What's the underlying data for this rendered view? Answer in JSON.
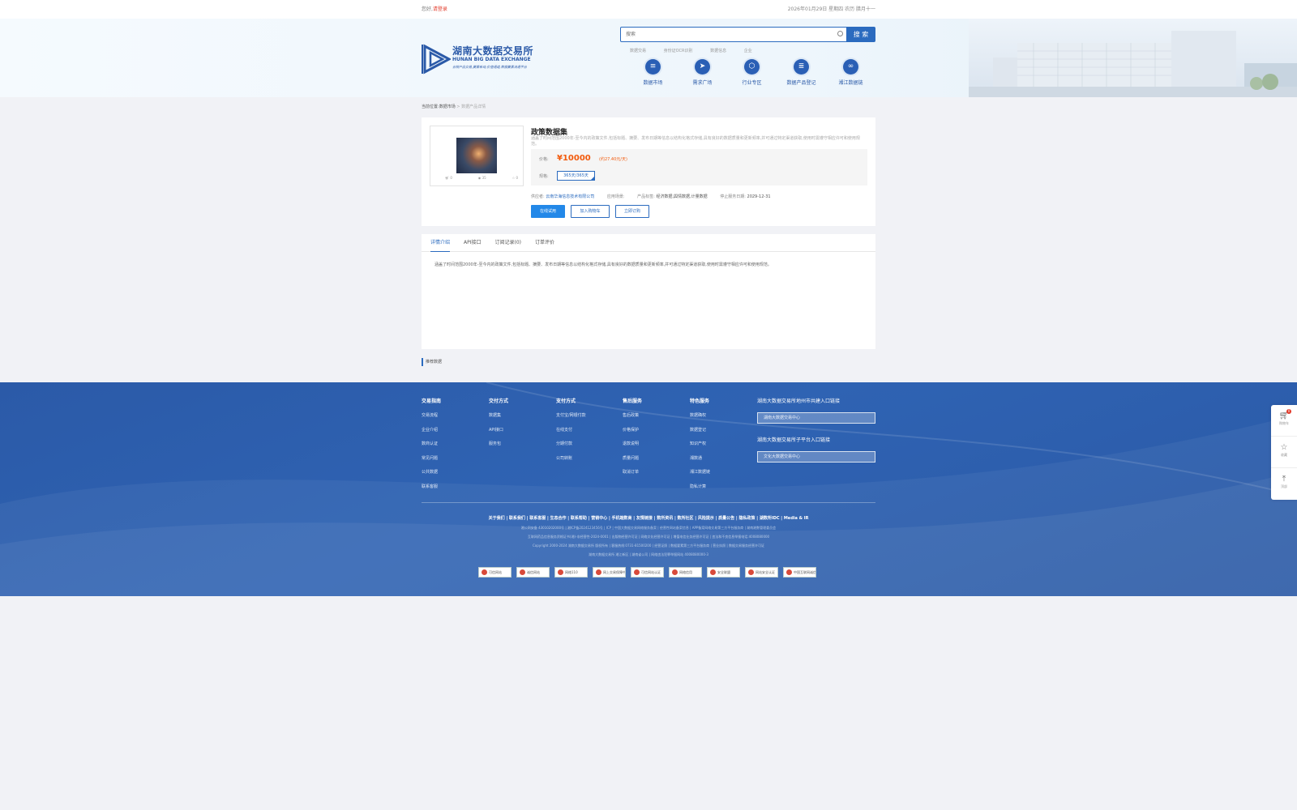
{
  "topbar": {
    "greeting": "您好,",
    "login_link": "请登录",
    "date": "2026年01月29日 星期四 农历 腊月十一"
  },
  "header": {
    "logo_cn": "湖南大数据交易所",
    "logo_en": "HUNAN BIG DATA EXCHANGE",
    "logo_slogan": "合规产品交易,要素新动,价值通道,数据要素流通平台",
    "search_placeholder": "搜索",
    "search_button": "搜 索",
    "hotwords": [
      "数据交易",
      "身份证OCR识别",
      "数据信息",
      "企业"
    ],
    "nav": [
      {
        "label": "数据市场",
        "icon": "database-icon",
        "glyph": "≡"
      },
      {
        "label": "需求广场",
        "icon": "compass-icon",
        "glyph": "➤"
      },
      {
        "label": "行业专区",
        "icon": "cube-icon",
        "glyph": "⬡"
      },
      {
        "label": "数据产品登记",
        "icon": "register-icon",
        "glyph": "≣"
      },
      {
        "label": "湘江数据链",
        "icon": "chain-link-icon",
        "glyph": "∞"
      }
    ]
  },
  "breadcrumb": {
    "prefix": "当前位置:",
    "level1": "数据市场",
    "separator": " > ",
    "current": "数据产品详情"
  },
  "product": {
    "title": "政策数据集",
    "description": "涵盖了时间范围2000年-至今内的政策文件,包括标题、摘要、发布日期等信息以结构化格式存储,具有良好的数据质量和更新频率,并可通过特定渠道获取,使用时需遵守相应许可和使用规范。",
    "cart_count": "0",
    "view_count": "35",
    "fav_count": "0",
    "price_label": "价格:",
    "price_value": "¥10000",
    "price_unit": "(约27.40元/天)",
    "spec_label": "规格:",
    "spec_value": "365天/365天",
    "provider_label": "供应者:",
    "provider_value": "云南华海信息技术有限公司",
    "scene_label": "应用场景:",
    "scene_value": "",
    "tags_label": "产品标签:",
    "tags_value": "经济数据,舆情数据,计量数据",
    "stop_label": "停止服务日期:",
    "stop_value": "2029-12-31",
    "btn_trial": "在线试用",
    "btn_cart": "加入购物车",
    "btn_buy": "立即订购"
  },
  "tabs": {
    "items": [
      "详情介绍",
      "API接口",
      "订阅记录(0)",
      "订单评价"
    ],
    "content": "涵盖了时间范围2000年-至今内的政策文件,包括标题、摘要、发布日期等信息以结构化格式存储,具有良好的数据质量和更新频率,并可通过特定渠道获取,使用时需遵守相应许可和使用规范。"
  },
  "recommend": {
    "title": "推荐数据"
  },
  "footer": {
    "columns": [
      {
        "title": "交易指南",
        "items": [
          "交易流程",
          "企业介绍",
          "数商认证",
          "常见问题",
          "公共数据",
          "联系客服"
        ]
      },
      {
        "title": "交付方式",
        "items": [
          "数据集",
          "API接口",
          "服务包"
        ]
      },
      {
        "title": "支付方式",
        "items": [
          "支付宝/网银付款",
          "在线支付",
          "分期付款",
          "公司转账"
        ]
      },
      {
        "title": "售后服务",
        "items": [
          "售后政策",
          "价格保护",
          "退款说明",
          "质量问题",
          "取消订单"
        ]
      },
      {
        "title": "特色服务",
        "items": [
          "数据确权",
          "数据登记",
          "知识产权",
          "湘数通",
          "湘江数据链",
          "隐私计算"
        ]
      }
    ],
    "city_links_title": "湖南大数据交易所地州市共建入口链接",
    "city_links_input": "湖南大数据交易中心",
    "sub_links_title": "湖南大数据交易所子平台入口链接",
    "sub_links_input": "文化大数据交易中心",
    "bottom_nav": [
      "关于我们",
      "联系我们",
      "联系客服",
      "生态合作",
      "联系帮助",
      "营销中心",
      "手机端数商",
      "友情链接",
      "数所资讯",
      "数所社区",
      "风险提示",
      "质量公告",
      "隐私政策",
      "湖数所IDC",
      "Media & IR"
    ],
    "info_lines": [
      "湘公网安备 43010202000号 | 湘ICP备2024123456号 | ICP | 中国大数据交易网络服务备案 | 经营性网站备案信息 | APP备案网络交易第三方平台服务商 | 湖南湘数管理委员会",
      "互联网药品信息服务资格证书(湘)-非经营性-2024-0001 | 出版物经营许可证 | 网络文化经营许可证 | 增值电信业务经营许可证 | 违法和不良信息举报电话:4008080000",
      "Copyright 2000-2024 湖南大数据交易所 版权所有 | 客服热线:0731-81500200 | 经营证照 | 数据要素第三方平台服务商 | 营业执照 | 数据交易服务经营许可证",
      "湖南大数据交易所 湘江新区 | 湖南省公司 | 网络违法犯罪举报网站 4008080000-3"
    ],
    "badges": [
      "可信网站",
      "诚信网站",
      "网络110",
      "网上交易保障中心",
      "可信网站认证",
      "网络信用",
      "安全联盟",
      "网站安全认证",
      "中国互联网诚信"
    ]
  },
  "side_toolbar": {
    "cart_label": "购物车",
    "cart_count": "0",
    "fav_label": "收藏",
    "top_label": "顶部"
  }
}
